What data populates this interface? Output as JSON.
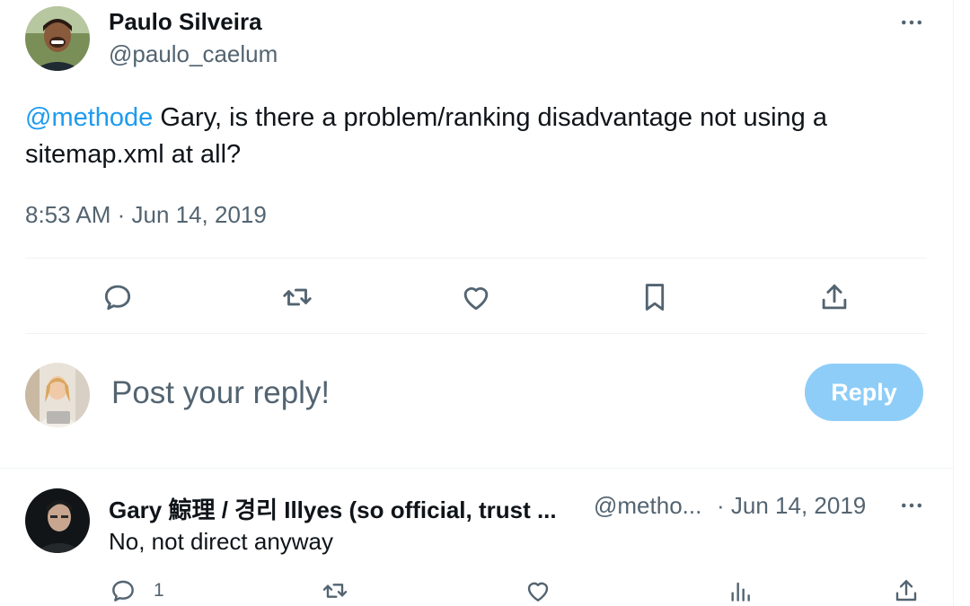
{
  "tweet": {
    "author_name": "Paulo Silveira",
    "author_handle": "@paulo_caelum",
    "mention": "@methode",
    "text": " Gary, is there a problem/ranking disadvantage not using a sitemap.xml at all?",
    "timestamp": "8:53 AM · Jun 14, 2019",
    "actions": [
      "reply-icon",
      "retweet-icon",
      "like-icon",
      "bookmark-icon",
      "share-icon"
    ]
  },
  "composer": {
    "placeholder": "Post your reply!",
    "button_label": "Reply",
    "button_color": "#8ecdf8"
  },
  "reply": {
    "author_name": "Gary 鯨理 / 경리 Illyes (so official, trust ...",
    "author_handle": "@metho...",
    "date": "· Jun 14, 2019",
    "text": "No, not direct anyway",
    "reply_count": "1",
    "actions": [
      "reply-icon",
      "retweet-icon",
      "like-icon",
      "views-icon",
      "share-icon"
    ]
  },
  "colors": {
    "accent": "#1d9bf0",
    "secondary_text": "#536471",
    "primary_text": "#0f1419",
    "divider": "#eff3f4"
  }
}
